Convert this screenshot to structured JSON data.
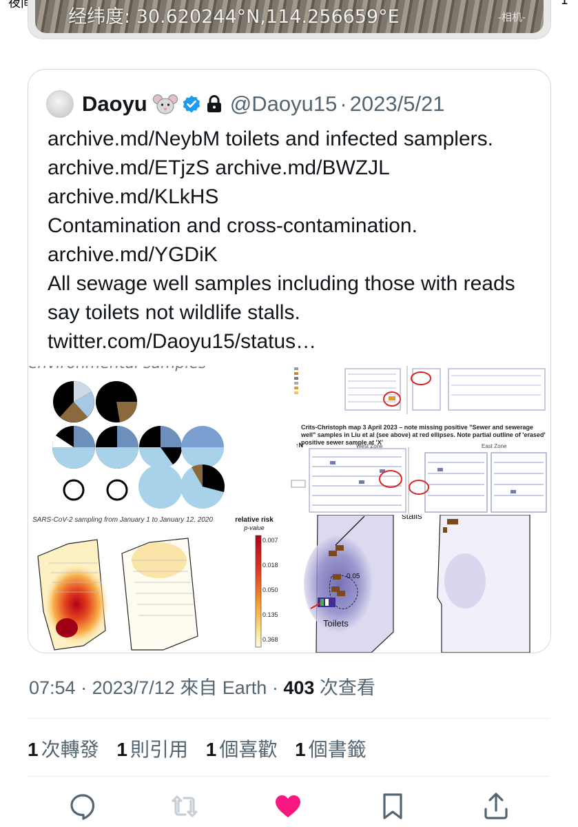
{
  "status_bar": {
    "left": "夜间服务",
    "right": "1"
  },
  "top_photo": {
    "coordinates": "经纬度: 30.620244°N,114.256659°E",
    "camera_label": "-相机-"
  },
  "quote": {
    "author_name": "Daoyu",
    "author_handle": "@Daoyu15",
    "separator": "·",
    "date": "2023/5/21",
    "icons": [
      "mouse-face-icon",
      "verified-badge-icon",
      "lock-icon"
    ],
    "text": "archive.md/NeybM toilets and infected samplers. archive.md/ETjzS archive.md/BWZJL archive.md/KLkHS\nContamination and cross-contamination. archive.md/YGDiK\nAll sewage well samples including those with reads say toilets not wildlife stalls. twitter.com/Daoyu15/status…",
    "media": {
      "image1_caption": "environmental samples",
      "image2_title": "Crits-Christoph map 3 April 2023 – note missing positive \"Sewer and sewerage well\" samples in Liu et al (see above) at red ellipses. Note partial outline of 'erased' positive sewer sample at 'X'",
      "image2_north": "↑N",
      "image2_zone_west": "West Zone",
      "image2_zone_east": "East Zone",
      "image3_caption": "SARS-CoV-2 sampling from January 1 to January 12, 2020",
      "image3_legend_title": "relative risk",
      "image3_legend_sub": "p-value",
      "image3_ticks": [
        "0.007",
        "0.018",
        "0.050",
        "0.135",
        "0.368"
      ],
      "image4_label_toilets": "Toilets",
      "image4_label_stalls": "stalls",
      "image4_contour": "0.05"
    }
  },
  "meta": {
    "time": "07:54",
    "dot": "·",
    "date": "2023/7/12",
    "source": "來自 Earth",
    "views_count": "403",
    "views_label": "次查看"
  },
  "stats": [
    {
      "count": "1",
      "label": "次轉發"
    },
    {
      "count": "1",
      "label": "則引用"
    },
    {
      "count": "1",
      "label": "個喜歡"
    },
    {
      "count": "1",
      "label": "個書籤"
    }
  ],
  "colors": {
    "like": "#f91880",
    "text_secondary": "#536471",
    "verified": "#1d9bf0",
    "border": "#cfd9de"
  }
}
